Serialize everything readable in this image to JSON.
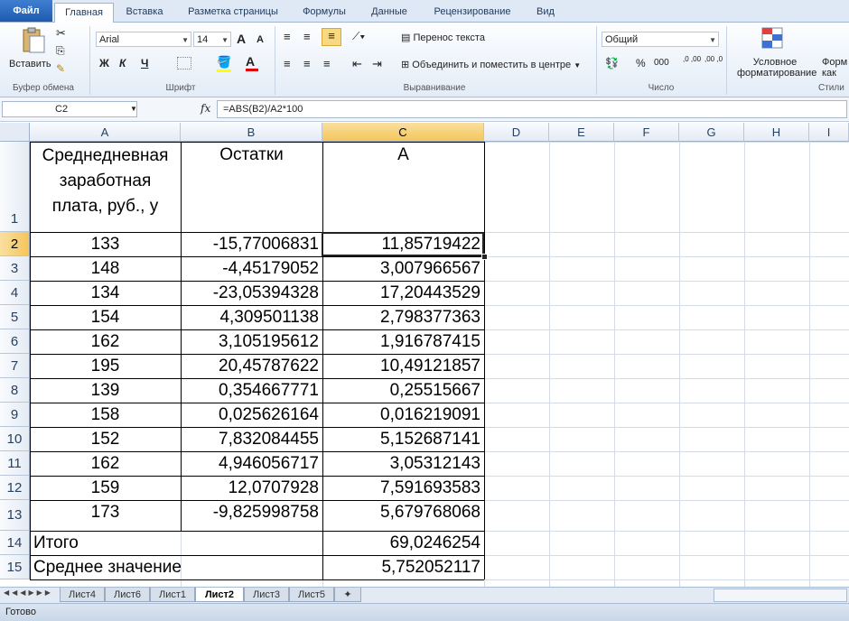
{
  "tabs": {
    "file": "Файл",
    "items": [
      "Главная",
      "Вставка",
      "Разметка страницы",
      "Формулы",
      "Данные",
      "Рецензирование",
      "Вид"
    ]
  },
  "ribbon": {
    "clipboard": {
      "paste": "Вставить",
      "label": "Буфер обмена"
    },
    "font": {
      "name": "Arial",
      "size": "14",
      "label": "Шрифт",
      "bold": "Ж",
      "italic": "К",
      "underline": "Ч",
      "grow": "A",
      "shrink": "A"
    },
    "alignment": {
      "wrap": "Перенос текста",
      "merge": "Объединить и поместить в центре",
      "label": "Выравнивание"
    },
    "number": {
      "format": "Общий",
      "percent": "%",
      "thousands": "000",
      "inc": ",0 ,00",
      "dec": ",00 ,0",
      "label": "Число"
    },
    "styles": {
      "conditional1": "Условное",
      "conditional2": "форматирование",
      "format1": "Форм",
      "format2": "как",
      "label": "Стили"
    }
  },
  "formula_bar": {
    "name_box": "C2",
    "fx": "fx",
    "formula": "=ABS(B2)/A2*100"
  },
  "columns": [
    "A",
    "B",
    "C",
    "D",
    "E",
    "F",
    "G",
    "H",
    "I"
  ],
  "rows": [
    "1",
    "2",
    "3",
    "4",
    "5",
    "6",
    "7",
    "8",
    "9",
    "10",
    "11",
    "12",
    "13",
    "14",
    "15"
  ],
  "header": {
    "a1": "Среднедневная",
    "a2": "заработная",
    "a3": "плата, руб., y",
    "b": "Остатки",
    "c": "A"
  },
  "table": [
    [
      "133",
      "-15,77006831",
      "11,85719422"
    ],
    [
      "148",
      "-4,45179052",
      "3,007966567"
    ],
    [
      "134",
      "-23,05394328",
      "17,20443529"
    ],
    [
      "154",
      "4,309501138",
      "2,798377363"
    ],
    [
      "162",
      "3,105195612",
      "1,916787415"
    ],
    [
      "195",
      "20,45787622",
      "10,49121857"
    ],
    [
      "139",
      "0,354667771",
      "0,25515667"
    ],
    [
      "158",
      "0,025626164",
      "0,016219091"
    ],
    [
      "152",
      "7,832084455",
      "5,152687141"
    ],
    [
      "162",
      "4,946056717",
      "3,05312143"
    ],
    [
      "159",
      "12,0707928",
      "7,591693583"
    ],
    [
      "173",
      "-9,825998758",
      "5,679768068"
    ]
  ],
  "total": {
    "label": "Итого",
    "value": "69,0246254"
  },
  "mean": {
    "label": "Среднее значение",
    "value": "5,752052117"
  },
  "sheets": [
    "Лист4",
    "Лист6",
    "Лист1",
    "Лист2",
    "Лист3",
    "Лист5"
  ],
  "active_sheet": "Лист2",
  "status": "Готово",
  "colors": {
    "accent": "#f5c55a",
    "ribbon": "#dfe9f5",
    "file_tab": "#2a66bd"
  }
}
